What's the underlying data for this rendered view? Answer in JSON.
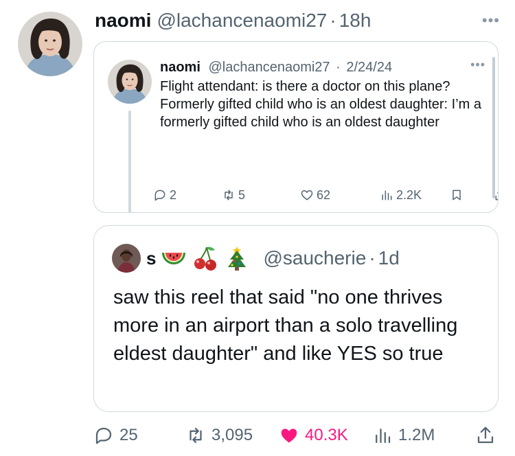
{
  "main_post": {
    "author_name": "naomi",
    "handle": "@lachancenaomi27",
    "time": "18h",
    "more_icon": "more-horizontal-icon"
  },
  "quoted_post": {
    "author_name": "naomi",
    "handle": "@lachancenaomi27",
    "date": "2/24/24",
    "text_line1": "Flight attendant: is there a doctor on this plane?",
    "text_line2": "Formerly gifted child who is an oldest daughter: I’m a formerly gifted child who is an oldest daughter",
    "replies": "2",
    "reposts": "5",
    "likes": "62",
    "views": "2.2K"
  },
  "second_post": {
    "author_name": "s",
    "emojis": [
      "watermelon-emoji",
      "cherries-emoji",
      "christmas-tree-emoji"
    ],
    "handle": "@saucherie",
    "time": "1d",
    "text": "saw this reel that said \"no one thrives more in an airport than a solo travelling eldest daughter\" and like YES so true"
  },
  "engagement": {
    "replies": "25",
    "reposts": "3,095",
    "likes": "40.3K",
    "views": "1.2M",
    "like_color": "#f91880"
  },
  "colors": {
    "text": "#0f1419",
    "secondary": "#536471",
    "border": "#cfd9de"
  }
}
